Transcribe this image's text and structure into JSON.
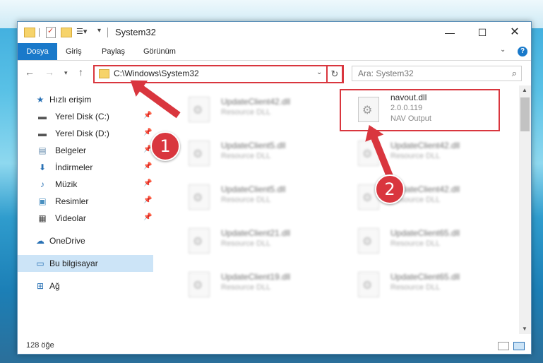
{
  "window": {
    "title": "System32"
  },
  "ribbon": {
    "tabs": [
      "Dosya",
      "Giriş",
      "Paylaş",
      "Görünüm"
    ]
  },
  "navigation": {
    "address": "C:\\Windows\\System32",
    "search_placeholder": "Ara: System32"
  },
  "sidebar": {
    "items": [
      {
        "label": "Hızlı erişim",
        "icon": "star-icon"
      },
      {
        "label": "Yerel Disk (C:)",
        "icon": "drive-icon",
        "pinned": true
      },
      {
        "label": "Yerel Disk (D:)",
        "icon": "drive-icon",
        "pinned": true
      },
      {
        "label": "Belgeler",
        "icon": "documents-icon",
        "pinned": true
      },
      {
        "label": "İndirmeler",
        "icon": "download-icon",
        "pinned": true
      },
      {
        "label": "Müzik",
        "icon": "music-icon",
        "pinned": true
      },
      {
        "label": "Resimler",
        "icon": "pictures-icon",
        "pinned": true
      },
      {
        "label": "Videolar",
        "icon": "video-icon",
        "pinned": true
      },
      {
        "label": "OneDrive",
        "icon": "cloud-icon"
      },
      {
        "label": "Bu bilgisayar",
        "icon": "computer-icon",
        "selected": true
      },
      {
        "label": "Ağ",
        "icon": "network-icon"
      }
    ]
  },
  "files": [
    {
      "name": "UpdateClient42.dll",
      "desc": "Resource DLL",
      "col": 0,
      "row": 0,
      "blur": true
    },
    {
      "name": "navout.dll",
      "desc": "NAV Output",
      "version": "2.0.0.119",
      "col": 1,
      "row": 0,
      "blur": false
    },
    {
      "name": "UpdateClient5.dll",
      "desc": "Resource DLL",
      "col": 0,
      "row": 1,
      "blur": true
    },
    {
      "name": "UpdateClient42.dll",
      "desc": "Resource DLL",
      "col": 1,
      "row": 1,
      "blur": true
    },
    {
      "name": "UpdateClient5.dll",
      "desc": "Resource DLL",
      "col": 0,
      "row": 2,
      "blur": true
    },
    {
      "name": "UpdateClient42.dll",
      "desc": "Resource DLL",
      "col": 1,
      "row": 2,
      "blur": true
    },
    {
      "name": "UpdateClient21.dll",
      "desc": "Resource DLL",
      "col": 0,
      "row": 3,
      "blur": true
    },
    {
      "name": "UpdateClient65.dll",
      "desc": "Resource DLL",
      "col": 1,
      "row": 3,
      "blur": true
    },
    {
      "name": "UpdateClient19.dll",
      "desc": "Resource DLL",
      "col": 0,
      "row": 4,
      "blur": true
    },
    {
      "name": "UpdateClient65.dll",
      "desc": "Resource DLL",
      "col": 1,
      "row": 4,
      "blur": true
    }
  ],
  "status": {
    "item_count": "128 öğe"
  },
  "callouts": [
    "1",
    "2"
  ],
  "colors": {
    "accent": "#1979ca",
    "highlight": "#d9363e",
    "selection": "#cce4f7"
  }
}
